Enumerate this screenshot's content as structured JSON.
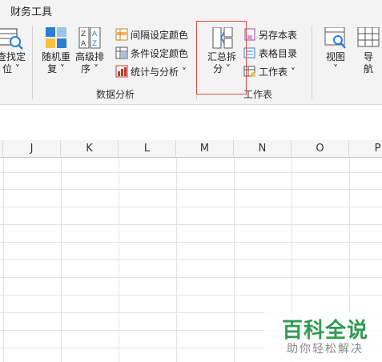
{
  "tab": {
    "label": "财务工具"
  },
  "ribbon": {
    "find_locate": {
      "line1": "查找定",
      "line2": "位 ˅"
    },
    "random_repeat": {
      "line1": "随机重",
      "line2": "复 ˅"
    },
    "advanced_sort": {
      "line1": "高级排",
      "line2": "序 ˅"
    },
    "interval_color": "间隔设定颜色",
    "condition_color": "条件设定颜色",
    "stats_analysis": "统计与分析 ˅",
    "data_analysis_group": "数据分析",
    "summary_split": {
      "line1": "汇总拆",
      "line2": "分 ˅"
    },
    "save_sheet": "另存本表",
    "sheet_directory": "表格目录",
    "worksheet": "工作表 ˅",
    "worksheet_group": "工作表",
    "view": {
      "line1": "视图",
      "line2": "˅"
    },
    "navigation": {
      "line1": "导",
      "line2": "航"
    }
  },
  "grid": {
    "columns": [
      "J",
      "K",
      "L",
      "M",
      "N",
      "O",
      "P"
    ]
  },
  "watermark": {
    "title": "百科全说",
    "subtitle": "助你轻松解决"
  },
  "colors": {
    "highlight_border": "#e04848",
    "watermark_green": "#2e9c52"
  }
}
